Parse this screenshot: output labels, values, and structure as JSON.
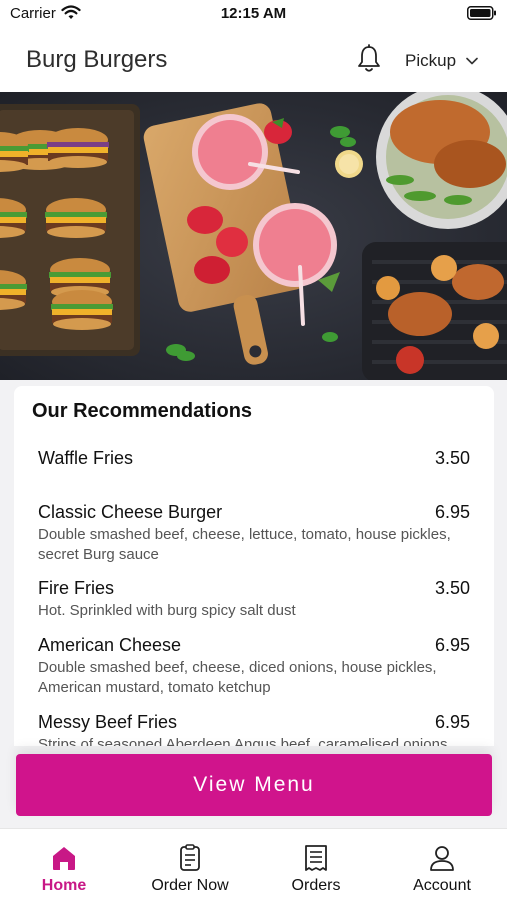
{
  "status_bar": {
    "carrier": "Carrier",
    "time": "12:15 AM"
  },
  "header": {
    "title": "Burg Burgers",
    "notification_icon": "bell-icon",
    "order_type": "Pickup"
  },
  "hero": {
    "image_subject": "food-photo"
  },
  "recommendations": {
    "title": "Our Recommendations",
    "items": [
      {
        "name": "Waffle Fries",
        "price": "3.50",
        "description": ""
      },
      {
        "name": "Classic Cheese Burger",
        "price": "6.95",
        "description": "Double smashed beef, cheese, lettuce, tomato, house pickles, secret Burg sauce"
      },
      {
        "name": "Fire Fries",
        "price": "3.50",
        "description": "Hot. Sprinkled with burg spicy salt dust"
      },
      {
        "name": "American Cheese",
        "price": "6.95",
        "description": "Double smashed beef, cheese, diced onions, house pickles, American mustard, tomato ketchup"
      },
      {
        "name": "Messy Beef Fries",
        "price": "6.95",
        "description": "Strips of seasoned Aberdeen Angus beef, caramelised onions"
      }
    ]
  },
  "view_menu": {
    "label": "View Menu"
  },
  "tabs": [
    {
      "label": "Home",
      "icon": "home-icon",
      "active": true
    },
    {
      "label": "Order Now",
      "icon": "order-icon",
      "active": false
    },
    {
      "label": "Orders",
      "icon": "receipt-icon",
      "active": false
    },
    {
      "label": "Account",
      "icon": "user-icon",
      "active": false
    }
  ],
  "colors": {
    "accent": "#d0148c",
    "active_tab": "#c81886"
  }
}
